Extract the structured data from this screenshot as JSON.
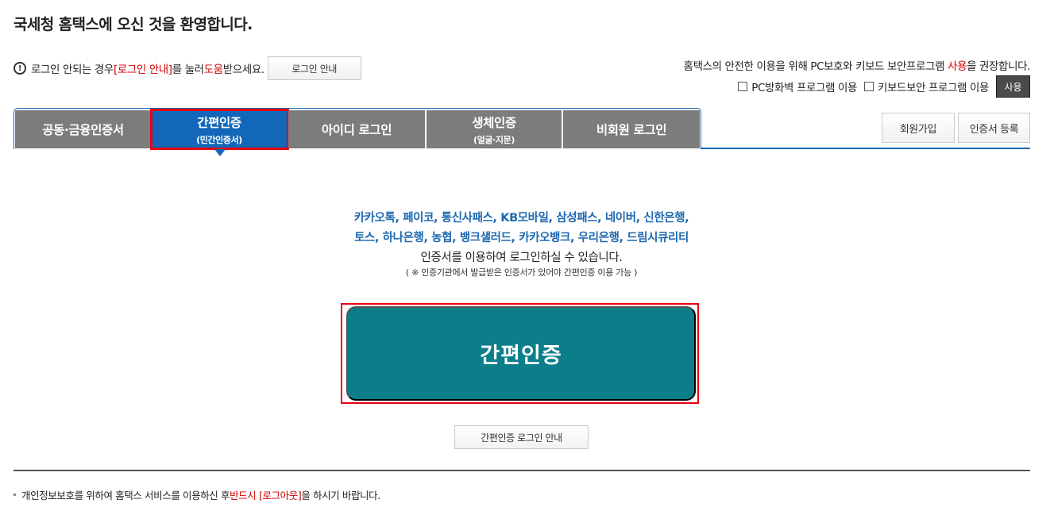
{
  "page": {
    "title": "국세청 홈택스에 오신 것을 환영합니다."
  },
  "help": {
    "icon": "info-circle-icon",
    "text_before": "로그인 안되는 경우 ",
    "link_text": "[로그인 안내]",
    "text_middle": "를 눌러 ",
    "highlight": "도움",
    "text_after": "받으세요.",
    "button_label": "로그인 안내"
  },
  "security": {
    "note_before": "홈택스의 안전한 이용을 위해 PC보호와 키보드 보안프로그램 ",
    "note_highlight": "사용",
    "note_after": "을 권장합니다.",
    "firewall_label": "PC방화벽 프로그램 이용",
    "keyboard_label": "키보드보안 프로그램 이용",
    "use_button": "사용"
  },
  "tabs": [
    {
      "label": "공동·금융인증서",
      "sub": ""
    },
    {
      "label": "간편인증",
      "sub": "(민간인증서)"
    },
    {
      "label": "아이디 로그인",
      "sub": ""
    },
    {
      "label": "생체인증",
      "sub": "(얼굴·지문)"
    },
    {
      "label": "비회원 로그인",
      "sub": ""
    }
  ],
  "actions": {
    "signup": "회원가입",
    "register_cert": "인증서 등록"
  },
  "content": {
    "providers_line1": "카카오톡, 페이코, 통신사패스, KB모바일, 삼성패스, 네이버, 신한은행,",
    "providers_line2": "토스, 하나은행, 농협, 뱅크샐러드, 카카오뱅크, 우리은행, 드림시큐리티",
    "desc_line": "인증서를 이용하여 로그인하실 수 있습니다.",
    "note": "( ※ 인증기관에서 발급받은 인증서가 있어야 간편인증 이용 가능 )",
    "main_button": "간편인증",
    "guide_button": "간편인증 로그인 안내"
  },
  "footer": {
    "text_before": "개인정보보호를 위하여 홈택스 서비스를 이용하신 후 ",
    "highlight": "반드시 [로그아웃]",
    "text_after": "을 하시기 바랍니다."
  },
  "colors": {
    "tab_gray": "#7c7c7c",
    "tab_active": "#1267b9",
    "main_button": "#0b7e8a",
    "highlight_red": "#d10000",
    "annotation_red": "#e60012"
  }
}
